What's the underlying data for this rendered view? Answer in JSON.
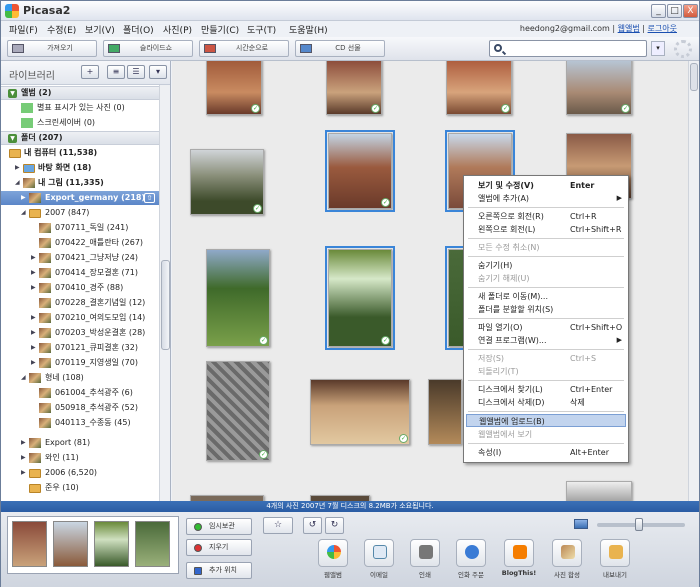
{
  "window": {
    "title": "Picasa2",
    "controls": [
      "_",
      "□",
      "X"
    ]
  },
  "menu": [
    "파일(F)",
    "수정(E)",
    "보기(V)",
    "폴더(O)",
    "사진(P)",
    "만들기(C)",
    "도구(T)",
    "도움말(H)"
  ],
  "account": {
    "email": "heedong2@gmail.com",
    "web_album": "웹앨범",
    "logout": "로그아웃",
    "sep": "|"
  },
  "toolbar": {
    "import": "가져오기",
    "slideshow": "슬라이드쇼",
    "timeline": "시간순으로",
    "cd": "CD 선물",
    "search_value": ""
  },
  "sidebar": {
    "title": "라이브러리",
    "sections": [
      {
        "label": "앨범 (2)"
      },
      {
        "label": "폴더 (207)"
      }
    ],
    "album_items": [
      "별표 표시가 있는 사진 (0)",
      "스크린세이버 (0)"
    ],
    "folder_items": [
      "내 컴퓨터 (11,538)",
      "바탕 화면 (18)",
      "내 그림 (11,335)",
      "Export_germany (218)",
      "2007 (847)",
      "070711_독일 (241)",
      "070422_애틀란타 (267)",
      "070421_그냥저냥 (24)",
      "070414_장모결혼 (71)",
      "070410_경주 (88)",
      "070228_결혼기념일 (12)",
      "070210_여의도모임 (14)",
      "070203_박성운결혼 (28)",
      "070121_큐피결혼 (32)",
      "070119_지영생일 (70)",
      "형네 (108)",
      "061004_추석광주 (6)",
      "050918_추석광주 (52)",
      "040113_수종동 (45)",
      "Export (81)",
      "와인 (11)",
      "2006 (6,520)",
      "준우 (10)"
    ]
  },
  "context_menu": [
    {
      "label": "보기 및 수정(V)",
      "shortcut": "Enter",
      "bold": true
    },
    {
      "label": "앨범에 추가(A)",
      "arrow": "▶"
    },
    {
      "sep": true
    },
    {
      "label": "오른쪽으로 회전(R)",
      "shortcut": "Ctrl+R"
    },
    {
      "label": "왼쪽으로 회전(L)",
      "shortcut": "Ctrl+Shift+R"
    },
    {
      "sep": true
    },
    {
      "label": "모든 수정 취소(N)",
      "disabled": true
    },
    {
      "sep": true
    },
    {
      "label": "숨기기(H)"
    },
    {
      "label": "숨기기 해제(U)",
      "disabled": true
    },
    {
      "sep": true
    },
    {
      "label": "새 폴더로 이동(M)..."
    },
    {
      "label": "폴더를 분할할 위치(S)"
    },
    {
      "sep": true
    },
    {
      "label": "파일 열기(O)",
      "shortcut": "Ctrl+Shift+O"
    },
    {
      "label": "연결 프로그램(W)...",
      "arrow": "▶"
    },
    {
      "sep": true
    },
    {
      "label": "저장(S)",
      "shortcut": "Ctrl+S",
      "disabled": true
    },
    {
      "label": "되돌리기(T)",
      "disabled": true
    },
    {
      "sep": true
    },
    {
      "label": "디스크에서 찾기(L)",
      "shortcut": "Ctrl+Enter"
    },
    {
      "label": "디스크에서 삭제(D)",
      "shortcut": "삭제"
    },
    {
      "sep": true
    },
    {
      "label": "웹앨범에 업로드(B)",
      "highlight": true
    },
    {
      "label": "웹앨범에서 보기",
      "disabled": true
    },
    {
      "sep": true
    },
    {
      "label": "속성(I)",
      "shortcut": "Alt+Enter"
    }
  ],
  "status": "4개의 사진   2007년 7월   디스크의 8.2MB가 소요됩니다.",
  "bottom": {
    "hold": "임시보관",
    "clear": "지우기",
    "add_to": "추가 위치",
    "actions": [
      "웹앨범",
      "이메일",
      "인쇄",
      "인화 주문",
      "BlogThis!",
      "사진 합성",
      "내보내기"
    ]
  },
  "colors": {
    "accent": "#2a5ca3",
    "selection": "#5b86c8",
    "folder": "#e9b34f",
    "album_tri": "#4b8f3a"
  },
  "thumbnail_zoom_percent": 48
}
